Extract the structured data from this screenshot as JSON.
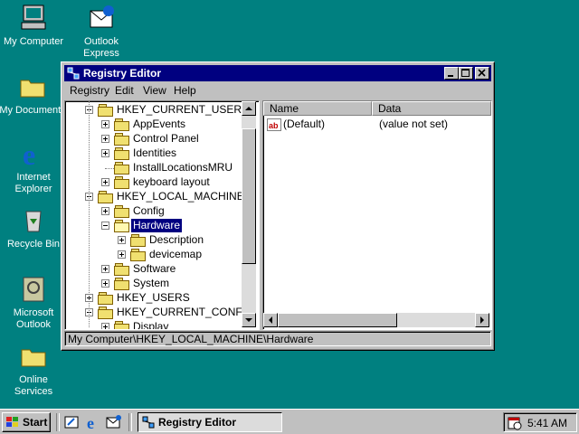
{
  "desktop": {
    "icons": [
      {
        "name": "My Computer"
      },
      {
        "name": "Outlook Express"
      },
      {
        "name": "My Documents"
      },
      {
        "name": "Internet Explorer"
      },
      {
        "name": "Recycle Bin"
      },
      {
        "name": "Microsoft Outlook"
      },
      {
        "name": "Online Services"
      }
    ]
  },
  "window": {
    "title": "Registry Editor",
    "menu": [
      "Registry",
      "Edit",
      "View",
      "Help"
    ],
    "tree": [
      {
        "label": "HKEY_CURRENT_USER",
        "expander": "minus"
      },
      {
        "label": "AppEvents",
        "expander": "plus"
      },
      {
        "label": "Control Panel",
        "expander": "plus"
      },
      {
        "label": "Identities",
        "expander": "plus"
      },
      {
        "label": "InstallLocationsMRU",
        "expander": "none"
      },
      {
        "label": "keyboard layout",
        "expander": "plus"
      },
      {
        "label": "HKEY_LOCAL_MACHINE",
        "expander": "minus"
      },
      {
        "label": "Config",
        "expander": "plus"
      },
      {
        "label": "Hardware",
        "expander": "minus",
        "selected": true
      },
      {
        "label": "Description",
        "expander": "plus"
      },
      {
        "label": "devicemap",
        "expander": "plus"
      },
      {
        "label": "Software",
        "expander": "plus"
      },
      {
        "label": "System",
        "expander": "plus"
      },
      {
        "label": "HKEY_USERS",
        "expander": "plus"
      },
      {
        "label": "HKEY_CURRENT_CONFIG",
        "expander": "minus"
      },
      {
        "label": "Display",
        "expander": "plus"
      }
    ],
    "list": {
      "columns": [
        "Name",
        "Data"
      ],
      "rows": [
        {
          "name": "(Default)",
          "data": "(value not set)"
        }
      ]
    },
    "status": "My Computer\\HKEY_LOCAL_MACHINE\\Hardware"
  },
  "taskbar": {
    "start": "Start",
    "task": "Registry Editor",
    "time": "5:41 AM"
  },
  "colors": {
    "desktop": "#008080",
    "titlebar": "#000080",
    "face": "#c0c0c0"
  }
}
